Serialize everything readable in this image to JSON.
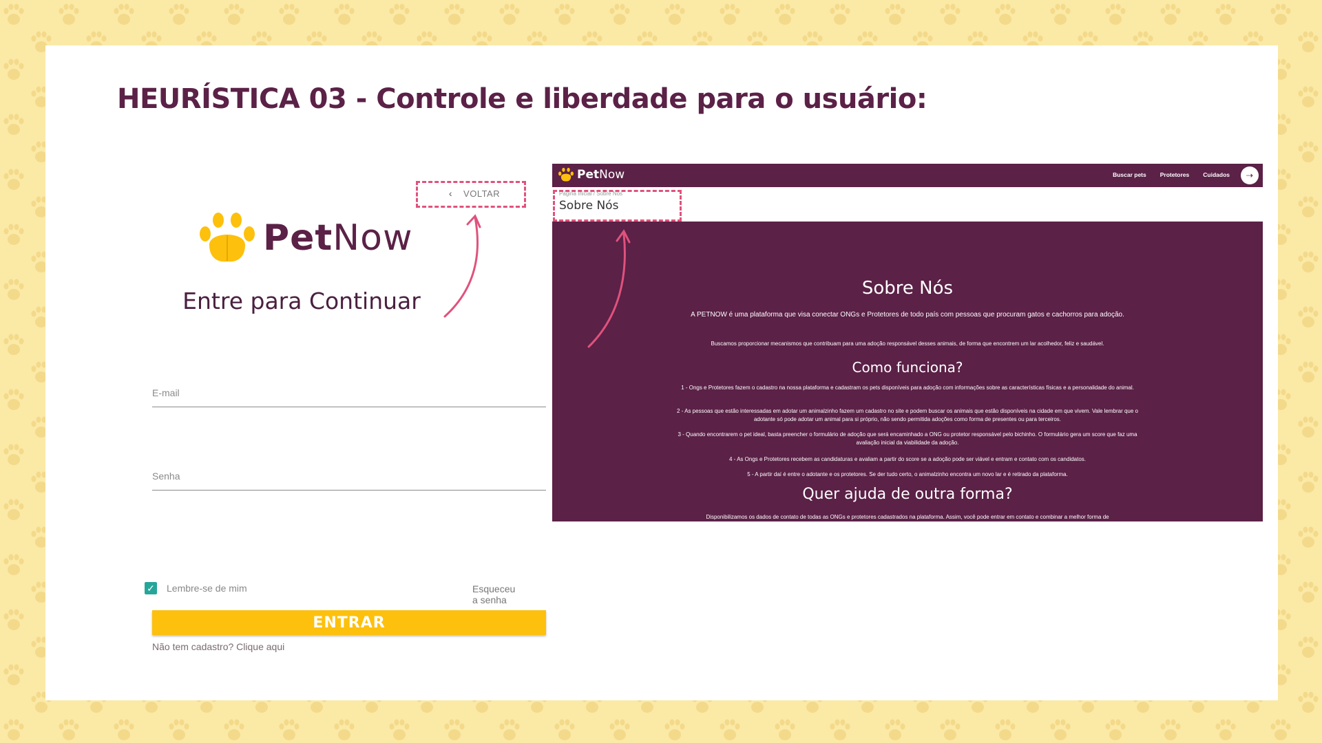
{
  "slide": {
    "title": "HEURÍSTICA 03 - Controle e liberdade para o usuário:"
  },
  "colors": {
    "background": "#fbe9a6",
    "brand_purple": "#5b2147",
    "accent_yellow": "#fdc00c",
    "highlight_pink": "#e0527c",
    "checkbox_teal": "#26a69a"
  },
  "login": {
    "back_label": "VOLTAR",
    "back_icon": "chevron-left-icon",
    "logo_bold": "Pet",
    "logo_light": "Now",
    "logo_icon": "paw-icon",
    "heading": "Entre para Continuar",
    "email_label": "E-mail",
    "password_label": "Senha",
    "remember_label": "Lembre-se de mim",
    "remember_checked": true,
    "forgot_label": "Esqueceu a senha",
    "submit_label": "ENTRAR",
    "signup_label": "Não tem cadastro? Clique aqui"
  },
  "site": {
    "logo_bold": "Pet",
    "logo_light": "Now",
    "nav": [
      "Buscar pets",
      "Protetores",
      "Cuidados"
    ],
    "login_icon": "login-icon",
    "breadcrumb": "Página Inicial / Sobre Nós",
    "page_title": "Sobre Nós",
    "about": {
      "title": "Sobre Nós",
      "intro": "A PETNOW é uma plataforma que visa conectar ONGs e Protetores de todo país com pessoas que procuram gatos e cachorros para adoção.",
      "intro2": "Buscamos proporcionar mecanismos que contribuam para uma adoção responsável desses animais, de forma que encontrem um lar acolhedor, feliz e saudável.",
      "how_title": "Como funciona?",
      "steps": [
        "1 - Ongs e Protetores fazem o cadastro na nossa plataforma e cadastram os pets disponíveis para adoção com informações sobre as características físicas e a personalidade do animal.",
        "2 - As pessoas que estão interessadas em adotar um animalzinho fazem um cadastro no site e podem buscar os animais que estão disponíveis na cidade em que vivem. Vale lembrar que o adotante só pode adotar um animal para si próprio, não sendo permitida adoções como forma de presentes ou para terceiros.",
        "3 - Quando encontrarem o pet ideal, basta preencher o formulário de adoção que será encaminhado a ONG ou protetor responsável pelo bichinho. O formulário gera um score que faz uma avaliação inicial da viabilidade da adoção.",
        "4 - As Ongs e Protetores recebem as candidaturas e avaliam a partir do score se a adoção pode ser viável e entram e contato com os candidatos.",
        "5 - A partir daí é entre o adotante e os protetores. Se der tudo certo, o animalzinho encontra um novo lar e é retirado da plataforma."
      ],
      "help_title": "Quer ajuda de outra forma?",
      "help_text": "Disponibilizamos os dados de contato de todas as ONGs e protetores cadastrados na plataforma. Assim, você pode entrar em contato e combinar a melhor forma de"
    }
  }
}
